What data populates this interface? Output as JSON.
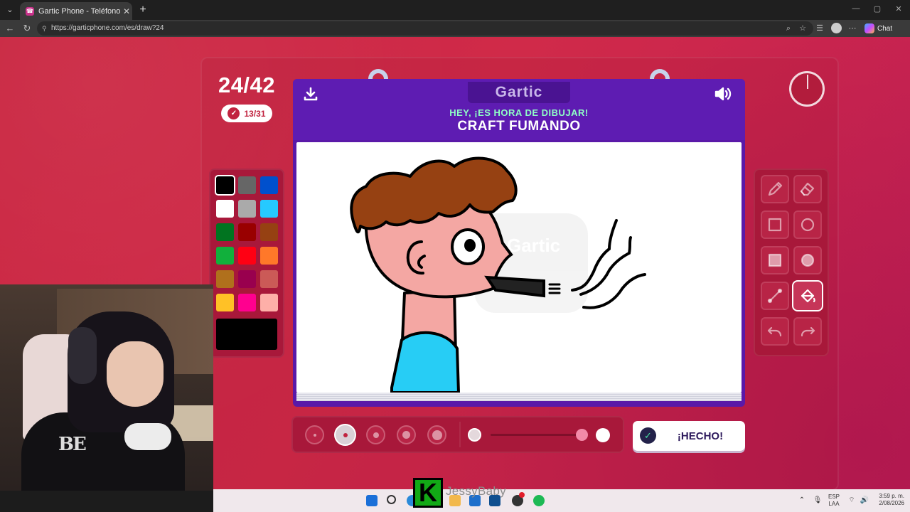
{
  "browser": {
    "tab_title": "Gartic Phone - Teléfono Descomp",
    "tab_close": "✕",
    "new_tab": "+",
    "url": "https://garticphone.com/es/draw?24",
    "chat_label": "Chat"
  },
  "game": {
    "round_counter": "24/42",
    "players_done": "13/31",
    "logo": "Gartic",
    "prompt_header": "HEY, ¡ES HORA DE DIBUJAR!",
    "prompt_word": "CRAFT FUMANDO",
    "done_label": "¡HECHO!",
    "palette": [
      {
        "name": "black",
        "color": "#000000"
      },
      {
        "name": "gray",
        "color": "#666666"
      },
      {
        "name": "blue",
        "color": "#0050cd"
      },
      {
        "name": "white",
        "color": "#ffffff"
      },
      {
        "name": "light-gray",
        "color": "#aaaaaa"
      },
      {
        "name": "cyan",
        "color": "#26c9ff"
      },
      {
        "name": "dark-green",
        "color": "#017420"
      },
      {
        "name": "dark-red",
        "color": "#990000"
      },
      {
        "name": "brown",
        "color": "#964112"
      },
      {
        "name": "green",
        "color": "#11b03c"
      },
      {
        "name": "red",
        "color": "#ff0013"
      },
      {
        "name": "orange",
        "color": "#ff7829"
      },
      {
        "name": "ochre",
        "color": "#b0701c"
      },
      {
        "name": "wine",
        "color": "#99004e"
      },
      {
        "name": "salmon",
        "color": "#cb5a57"
      },
      {
        "name": "yellow",
        "color": "#ffc126"
      },
      {
        "name": "magenta",
        "color": "#ff008f"
      },
      {
        "name": "pink",
        "color": "#feafa8"
      }
    ],
    "selected_color": "#000000",
    "selected_tool": "fill-bucket",
    "selected_stroke_size": 2,
    "tools": [
      "pencil-icon",
      "eraser-icon",
      "rect-outline-icon",
      "ellipse-outline-icon",
      "rect-fill-icon",
      "ellipse-fill-icon",
      "line-icon",
      "fill-bucket-icon",
      "undo-icon",
      "redo-icon"
    ]
  },
  "overlay": {
    "streamer_name": "JessyBaby",
    "streamer_badge": "K"
  },
  "taskbar": {
    "lang_top": "ESP",
    "lang_bottom": "LAA",
    "time": "3:59 p. m.",
    "date": "2/08/2026"
  },
  "colors": {
    "page_bg": "#d02a49",
    "board_purple": "#5e1cb2",
    "accent_green": "#8fffc6"
  }
}
